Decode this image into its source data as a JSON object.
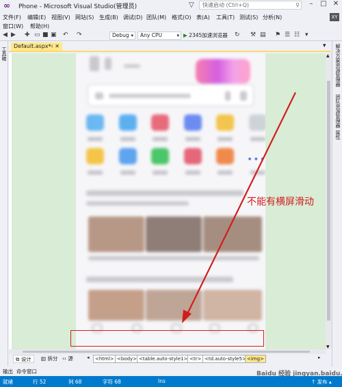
{
  "window": {
    "title": "Phone - Microsoft Visual Studio(管理员)",
    "quick_launch_placeholder": "快速启动 (Ctrl+Q)",
    "user_badge": "XY"
  },
  "menu": {
    "row1": [
      "文件(F)",
      "编辑(E)",
      "视图(V)",
      "网站(S)",
      "生成(B)",
      "调试(D)",
      "团队(M)",
      "格式(O)",
      "表(A)",
      "工具(T)",
      "测试(S)",
      "分析(N)"
    ],
    "row2": [
      "窗口(W)",
      "帮助(H)"
    ]
  },
  "toolbar": {
    "configuration": "Debug",
    "platform": "Any CPU",
    "run_label": "2345加速浏览器"
  },
  "left_rail": {
    "label": "工具箱"
  },
  "right_rail": {
    "labels": [
      "解决方案资源管理器",
      "团队资源管理器",
      "属性"
    ]
  },
  "document": {
    "tab_title": "Default.aspx*"
  },
  "annotation": {
    "text": "不能有横屏滑动"
  },
  "view_modes": {
    "design": "设计",
    "split": "拆分",
    "source": "源"
  },
  "breadcrumb": [
    "<html>",
    "<body>",
    "<table.auto-style1>",
    "<tr>",
    "<td.auto-style5>",
    "<img>"
  ],
  "tool_tabs": [
    "输出",
    "命令窗口"
  ],
  "status": {
    "state": "就绪",
    "line": "行 52",
    "col": "列 68",
    "char": "字符 68",
    "mode": "Ins",
    "publish": "↑ 发布 ▴"
  },
  "watermark": "Baidu 经验 jingyan.baidu.com",
  "colors": {
    "accent": "#007acc",
    "annotation": "#d11d1d",
    "tab_active": "#ffe88a",
    "designer_margin": "#d8ecd6"
  }
}
